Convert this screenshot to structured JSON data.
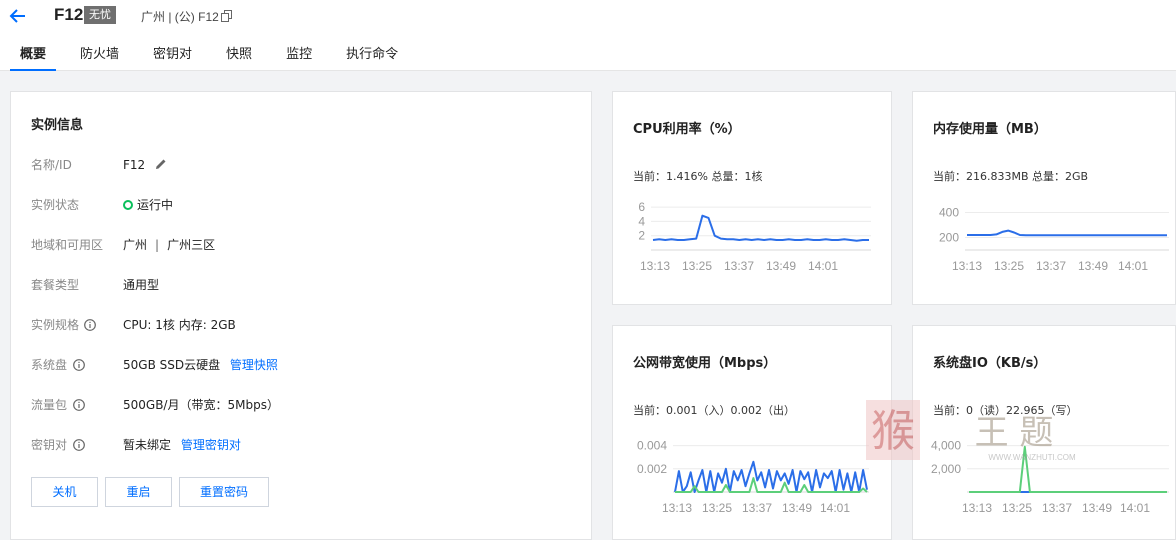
{
  "header": {
    "instance_name": "F12",
    "badge": "无忧",
    "region_text": "广州 | (公) F12"
  },
  "tabs": [
    {
      "label": "概要",
      "active": true
    },
    {
      "label": "防火墙",
      "active": false
    },
    {
      "label": "密钥对",
      "active": false
    },
    {
      "label": "快照",
      "active": false
    },
    {
      "label": "监控",
      "active": false
    },
    {
      "label": "执行命令",
      "active": false
    }
  ],
  "instance_info": {
    "title": "实例信息",
    "name_label": "名称/ID",
    "name_value": "F12",
    "status_label": "实例状态",
    "status_value": "运行中",
    "zone_label": "地域和可用区",
    "zone_region": "广州",
    "zone_separator": "|",
    "zone_zone": "广州三区",
    "package_label": "套餐类型",
    "package_value": "通用型",
    "spec_label": "实例规格",
    "spec_value": "CPU: 1核 内存: 2GB",
    "disk_label": "系统盘",
    "disk_value": "50GB SSD云硬盘",
    "disk_link": "管理快照",
    "traffic_label": "流量包",
    "traffic_value": "500GB/月（带宽：5Mbps）",
    "key_label": "密钥对",
    "key_value": "暂未绑定",
    "key_link": "管理密钥对"
  },
  "actions": {
    "shutdown": "关机",
    "restart": "重启",
    "reset_password": "重置密码"
  },
  "charts": {
    "cpu": {
      "title": "CPU利用率（%）",
      "current": "当前：1.416% 总量：1核"
    },
    "mem": {
      "title": "内存使用量（MB）",
      "current": "当前：216.833MB 总量：2GB"
    },
    "net": {
      "title": "公网带宽使用（Mbps）",
      "current": "当前：0.001（入）0.002（出）"
    },
    "disk": {
      "title": "系统盘IO（KB/s）",
      "current": "当前：0（读）22.965（写）"
    }
  },
  "chart_data": [
    {
      "type": "line",
      "x": [
        "13:13",
        "13:25",
        "13:37",
        "13:49",
        "14:01"
      ],
      "yticks": [
        2,
        4,
        6
      ],
      "ylim": [
        0,
        7
      ],
      "series": [
        {
          "color": "#2b6ee8",
          "values": [
            1.4,
            1.5,
            1.4,
            1.5,
            1.4,
            1.4,
            1.5,
            1.6,
            4.8,
            4.5,
            2.0,
            1.6,
            1.5,
            1.5,
            1.4,
            1.5,
            1.4,
            1.5,
            1.4,
            1.5,
            1.4,
            1.4,
            1.5,
            1.4,
            1.4,
            1.5,
            1.4,
            1.4,
            1.5,
            1.4,
            1.4,
            1.5,
            1.4,
            1.3,
            1.4,
            1.4
          ]
        }
      ]
    },
    {
      "type": "line",
      "x": [
        "13:13",
        "13:25",
        "13:37",
        "13:49",
        "14:01"
      ],
      "yticks": [
        200,
        400
      ],
      "ylim": [
        100,
        500
      ],
      "series": [
        {
          "color": "#2b6ee8",
          "values": [
            220,
            220,
            220,
            220,
            220,
            225,
            245,
            255,
            240,
            220,
            218,
            218,
            218,
            218,
            218,
            218,
            218,
            218,
            218,
            218,
            218,
            218,
            218,
            218,
            218,
            218,
            218,
            218,
            218,
            218,
            218,
            218,
            218,
            218,
            218
          ]
        }
      ]
    },
    {
      "type": "line",
      "x": [
        "13:13",
        "13:25",
        "13:37",
        "13:49",
        "14:01"
      ],
      "yticks": [
        "0.002",
        "0.004"
      ],
      "ylim": [
        0,
        0.005
      ],
      "series": [
        {
          "name": "",
          "color": "#2b6ee8",
          "values": [
            0,
            0.0018,
            0,
            0.0005,
            0.0017,
            0,
            0.001,
            0.0019,
            0,
            0.0018,
            0,
            0.0016,
            0.0008,
            0.002,
            0,
            0.0018,
            0.001,
            0.0019,
            0.0005,
            0.0016,
            0.0026,
            0.001,
            0.0017,
            0.0004,
            0.0019,
            0.0003,
            0.0018,
            0.001,
            0.0016,
            0.0007,
            0.0019,
            0,
            0.0018,
            0.0011,
            0.0017,
            0,
            0.0019,
            0.0004,
            0.0016,
            0.0012,
            0.0018,
            0,
            0.0019,
            0.0002,
            0.0016,
            0,
            0.0017,
            0,
            0.0019,
            0.0002
          ]
        },
        {
          "name": "",
          "color": "#5ccf7a",
          "values": [
            0,
            0,
            0,
            0,
            0,
            0.0005,
            0,
            0,
            0,
            0,
            0,
            0,
            0,
            0.0006,
            0,
            0,
            0,
            0,
            0,
            0,
            0.0012,
            0,
            0,
            0,
            0,
            0,
            0,
            0,
            0.0008,
            0,
            0,
            0,
            0,
            0.0006,
            0,
            0,
            0,
            0,
            0,
            0,
            0,
            0,
            0,
            0,
            0,
            0,
            0,
            0,
            0.0003,
            0
          ]
        }
      ]
    },
    {
      "type": "line",
      "x": [
        "13:13",
        "13:25",
        "13:37",
        "13:49",
        "14:01"
      ],
      "yticks": [
        "2,000",
        "4,000"
      ],
      "ylim": [
        0,
        5000
      ],
      "series": [
        {
          "name": "",
          "color": "#2b6ee8",
          "values": [
            0,
            0,
            0,
            0,
            0,
            0,
            0,
            0,
            0,
            0,
            0,
            0,
            0,
            0,
            0,
            0,
            0,
            0,
            0,
            0,
            0,
            0,
            0,
            0,
            0,
            0,
            0,
            0,
            0,
            0,
            0,
            0,
            0,
            0,
            0,
            0,
            0,
            0,
            0,
            0
          ]
        },
        {
          "name": "",
          "color": "#5ccf7a",
          "values": [
            0,
            0,
            0,
            0,
            0,
            0,
            0,
            0,
            0,
            0,
            0,
            3900,
            0,
            0,
            0,
            0,
            0,
            0,
            0,
            0,
            0,
            0,
            0,
            0,
            0,
            0,
            0,
            0,
            0,
            0,
            0,
            0,
            0,
            0,
            0,
            0,
            0,
            0,
            0,
            0
          ]
        }
      ]
    }
  ],
  "watermark": {
    "text": "王 题",
    "url": "WWW.WANZHUTI.COM"
  }
}
